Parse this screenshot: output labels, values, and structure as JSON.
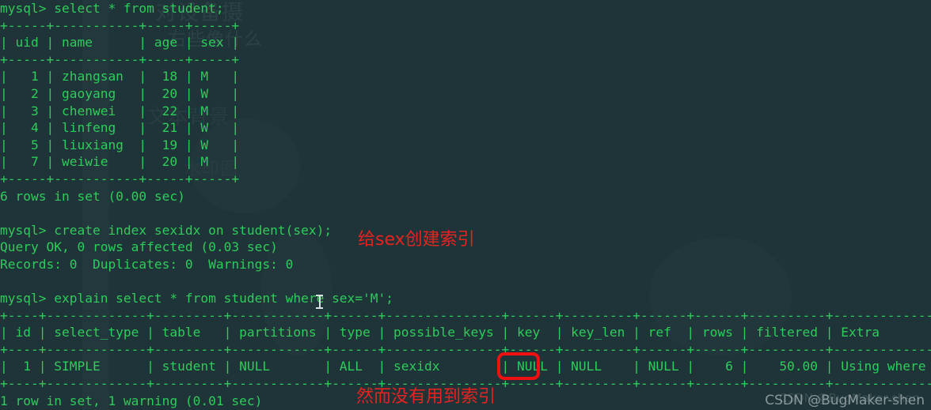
{
  "terminal": {
    "prompt": "mysql>",
    "foreground_color": "#2ecc5a",
    "background_color": "#1e3438",
    "lines": [
      "mysql> select * from student;",
      "+-----+-----------+-----+-----+",
      "| uid | name      | age | sex |",
      "+-----+-----------+-----+-----+",
      "|   1 | zhangsan  |  18 | M   |",
      "|   2 | gaoyang   |  20 | W   |",
      "|   3 | chenwei   |  22 | M   |",
      "|   4 | linfeng   |  21 | W   |",
      "|   5 | liuxiang  |  19 | W   |",
      "|   7 | weiwie    |  20 | M   |",
      "+-----+-----------+-----+-----+",
      "6 rows in set (0.00 sec)",
      "",
      "mysql> create index sexidx on student(sex);",
      "Query OK, 0 rows affected (0.03 sec)",
      "Records: 0  Duplicates: 0  Warnings: 0",
      "",
      "mysql> explain select * from student where sex='M';",
      "+----+-------------+---------+------------+------+---------------+------+---------+------+------+----------+-------------+",
      "| id | select_type | table   | partitions | type | possible_keys | key  | key_len | ref  | rows | filtered | Extra       |",
      "+----+-------------+---------+------------+------+---------------+------+---------+------+------+----------+-------------+",
      "|  1 | SIMPLE      | student | NULL       | ALL  | sexidx        | NULL | NULL    | NULL |    6 |    50.00 | Using where |",
      "+----+-------------+---------+------------+------+---------------+------+---------+------+------+----------+-------------+",
      "1 row in set, 1 warning (0.01 sec)"
    ]
  },
  "queries": {
    "select_all": "select * from student;",
    "create_index": "create index sexidx on student(sex);",
    "explain": "explain select * from student where sex='M';"
  },
  "student_table": {
    "columns": [
      "uid",
      "name",
      "age",
      "sex"
    ],
    "rows": [
      [
        "1",
        "zhangsan",
        "18",
        "M"
      ],
      [
        "2",
        "gaoyang",
        "20",
        "W"
      ],
      [
        "3",
        "chenwei",
        "22",
        "M"
      ],
      [
        "4",
        "linfeng",
        "21",
        "W"
      ],
      [
        "5",
        "liuxiang",
        "19",
        "W"
      ],
      [
        "7",
        "weiwie",
        "20",
        "M"
      ]
    ],
    "result_text": "6 rows in set (0.00 sec)"
  },
  "create_index_result": {
    "status": "Query OK, 0 rows affected (0.03 sec)",
    "details": "Records: 0  Duplicates: 0  Warnings: 0"
  },
  "explain_table": {
    "columns": [
      "id",
      "select_type",
      "table",
      "partitions",
      "type",
      "possible_keys",
      "key",
      "key_len",
      "ref",
      "rows",
      "filtered",
      "Extra"
    ],
    "rows": [
      [
        "1",
        "SIMPLE",
        "student",
        "NULL",
        "ALL",
        "sexidx",
        "NULL",
        "NULL",
        "NULL",
        "6",
        "50.00",
        "Using where"
      ]
    ],
    "result_text": "1 row in set, 1 warning (0.01 sec)"
  },
  "annotations": {
    "color": "#e8221f",
    "create_index_note": "给sex创建索引",
    "no_index_used_note": "然而没有用到索引",
    "highlight_target": "NULL",
    "highlight_column": "key",
    "highlight_color": "#f01010"
  },
  "watermark": {
    "text": "CSDN @BugMaker-shen"
  },
  "background_art": {
    "line1": "对设备摄",
    "line2": "右些像什么",
    "line3": "文本背景",
    "line4": "水印图"
  }
}
